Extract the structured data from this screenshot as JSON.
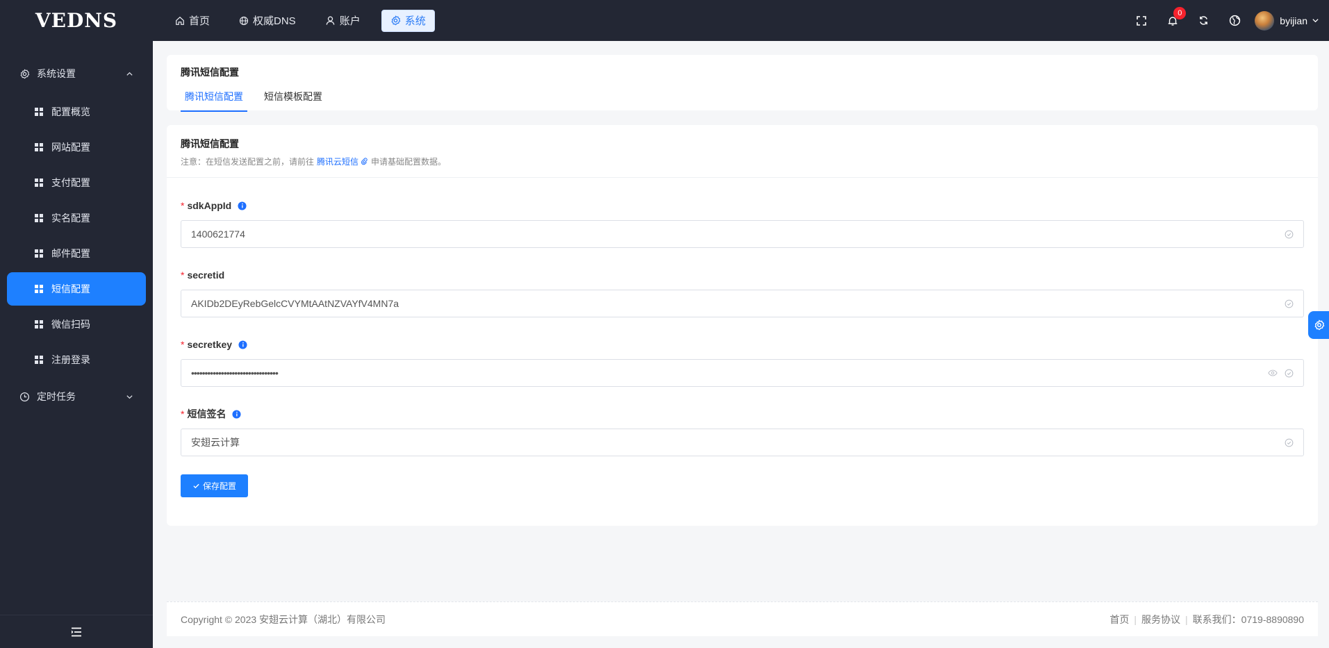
{
  "brand": {
    "logo": "VEDNS"
  },
  "topnav": [
    {
      "label": "首页",
      "icon": "home-icon"
    },
    {
      "label": "权威DNS",
      "icon": "globe-icon"
    },
    {
      "label": "账户",
      "icon": "user-icon"
    },
    {
      "label": "系统",
      "icon": "gear-icon",
      "active": true
    }
  ],
  "toolbar": {
    "notification_count": "0",
    "username": "byijian"
  },
  "sidebar": {
    "group1": "系统设置",
    "items": [
      "配置概览",
      "网站配置",
      "支付配置",
      "实名配置",
      "邮件配置",
      "短信配置",
      "微信扫码",
      "注册登录"
    ],
    "active_item": "短信配置",
    "group2": "定时任务"
  },
  "page": {
    "title": "腾讯短信配置",
    "tabs": [
      "腾讯短信配置",
      "短信模板配置"
    ]
  },
  "form": {
    "title": "腾讯短信配置",
    "note_prefix": "注意：在短信发送配置之前，请前往",
    "note_link": "腾讯云短信",
    "note_suffix": "申请基础配置数据。",
    "fields": [
      {
        "label": "sdkAppId",
        "value": "1400621774",
        "info": true
      },
      {
        "label": "secretid",
        "value": "AKIDb2DEyRebGelcCVYMtAAtNZVAYfV4MN7a",
        "info": false
      },
      {
        "label": "secretkey",
        "value": "••••••••••••••••••••••••••••••••",
        "info": true
      },
      {
        "label": "短信签名",
        "value": "安翅云计算",
        "info": true
      }
    ],
    "save_label": "保存配置"
  },
  "footer": {
    "copyright": "Copyright © 2023 安翅云计算（湖北）有限公司",
    "links": [
      "首页",
      "服务协议",
      "联系我们：0719-8890890"
    ]
  },
  "colors": {
    "sidebar_bg": "#232734",
    "accent": "#1e80ff",
    "required": "#f5222d"
  }
}
